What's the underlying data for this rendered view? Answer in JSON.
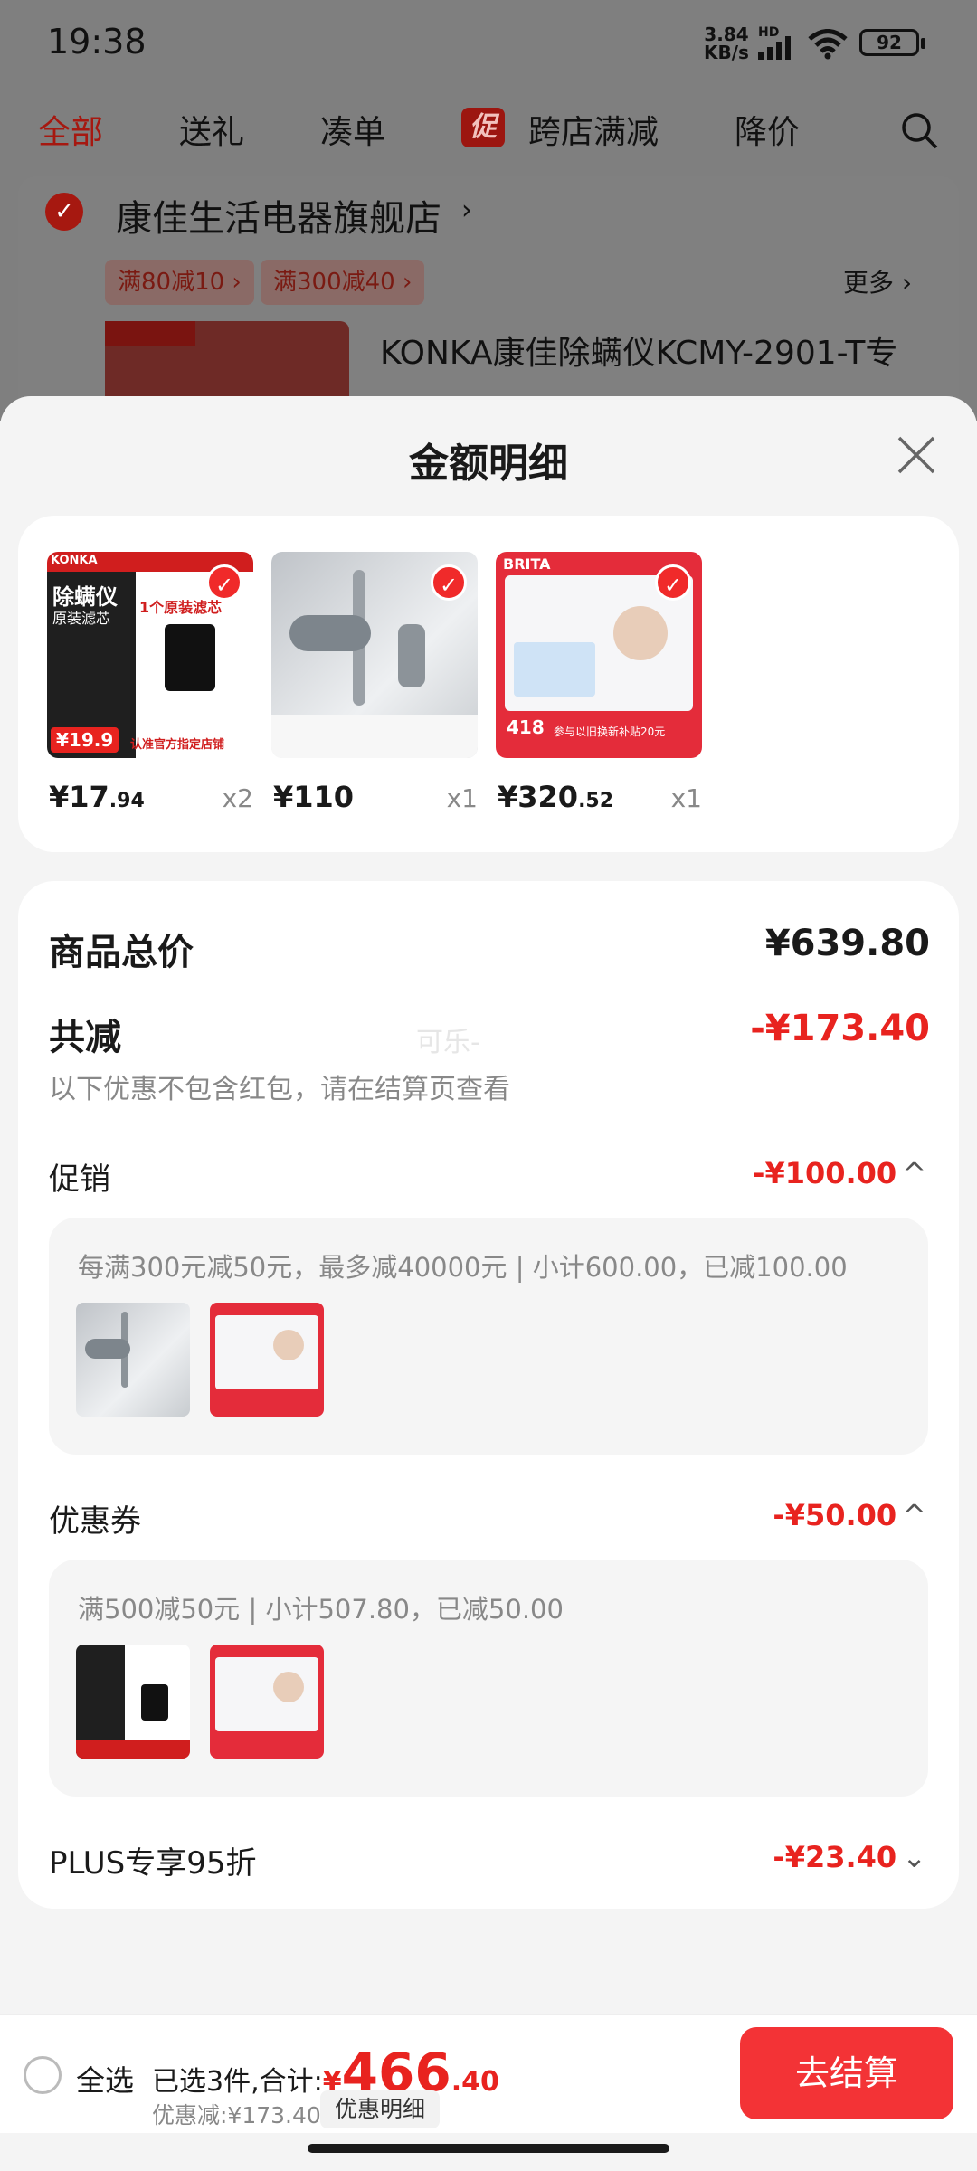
{
  "status_bar": {
    "time": "19:38",
    "net_speed_top": "3.84",
    "net_speed_bottom": "KB/s",
    "hd": "HD",
    "battery": "92"
  },
  "top_tabs": [
    {
      "label": "全部",
      "active": true
    },
    {
      "label": "送礼",
      "active": false
    },
    {
      "label": "凑单",
      "active": false
    },
    {
      "label": "跨店满减",
      "active": false,
      "tag": "促"
    },
    {
      "label": "降价",
      "active": false
    }
  ],
  "store": {
    "name": "康佳生活电器旗舰店",
    "chevron": "›",
    "coupons": [
      "满80减10 ›",
      "满300减40 ›"
    ],
    "more": "更多 ›",
    "product_title": "KONKA康佳除螨仪KCMY-2901-T专"
  },
  "sheet": {
    "title": "金额明细",
    "products": [
      {
        "price_main": "¥17",
        "price_dec": ".94",
        "qty": "x2",
        "img_text_1": "除螨仪",
        "img_text_2": "原装滤芯",
        "img_text_3": "1个原装滤芯",
        "img_price": "¥19.9",
        "img_footer": "认准官方指定店铺",
        "brand": "KONKA"
      },
      {
        "price_main": "¥110",
        "price_dec": "",
        "qty": "x1"
      },
      {
        "price_main": "¥320",
        "price_dec": ".52",
        "qty": "x1",
        "img_brand": "BRITA",
        "img_badge": "418",
        "img_footer": "参与以旧换新补贴20元"
      }
    ],
    "summary": {
      "total_label": "商品总价",
      "total_value": "¥639.80",
      "reduce_label": "共减",
      "reduce_value": "-¥173.40",
      "note": "以下优惠不包含红包，请在结算页查看",
      "watermark": "可乐-"
    },
    "promotion": {
      "label": "促销",
      "value": "-¥100.00",
      "chevron": "^",
      "desc": "每满300元减50元，最多减40000元 | 小计600.00，已减100.00"
    },
    "coupon": {
      "label": "优惠券",
      "value": "-¥50.00",
      "chevron": "^",
      "desc": "满500减50元 | 小计507.80，已减50.00"
    },
    "plus": {
      "label": "PLUS专享95折",
      "value": "-¥23.40",
      "chevron": "⌄"
    }
  },
  "bottom_bar": {
    "select_all": "全选",
    "selected_text": "已选3件,合计:",
    "currency": "¥",
    "total_int": "466",
    "total_dec": ".40",
    "saved": "优惠减:¥173.40",
    "detail_button": "优惠明细",
    "checkout": "去结算"
  },
  "colors": {
    "accent": "#f33336",
    "price_red": "#e8231f"
  }
}
